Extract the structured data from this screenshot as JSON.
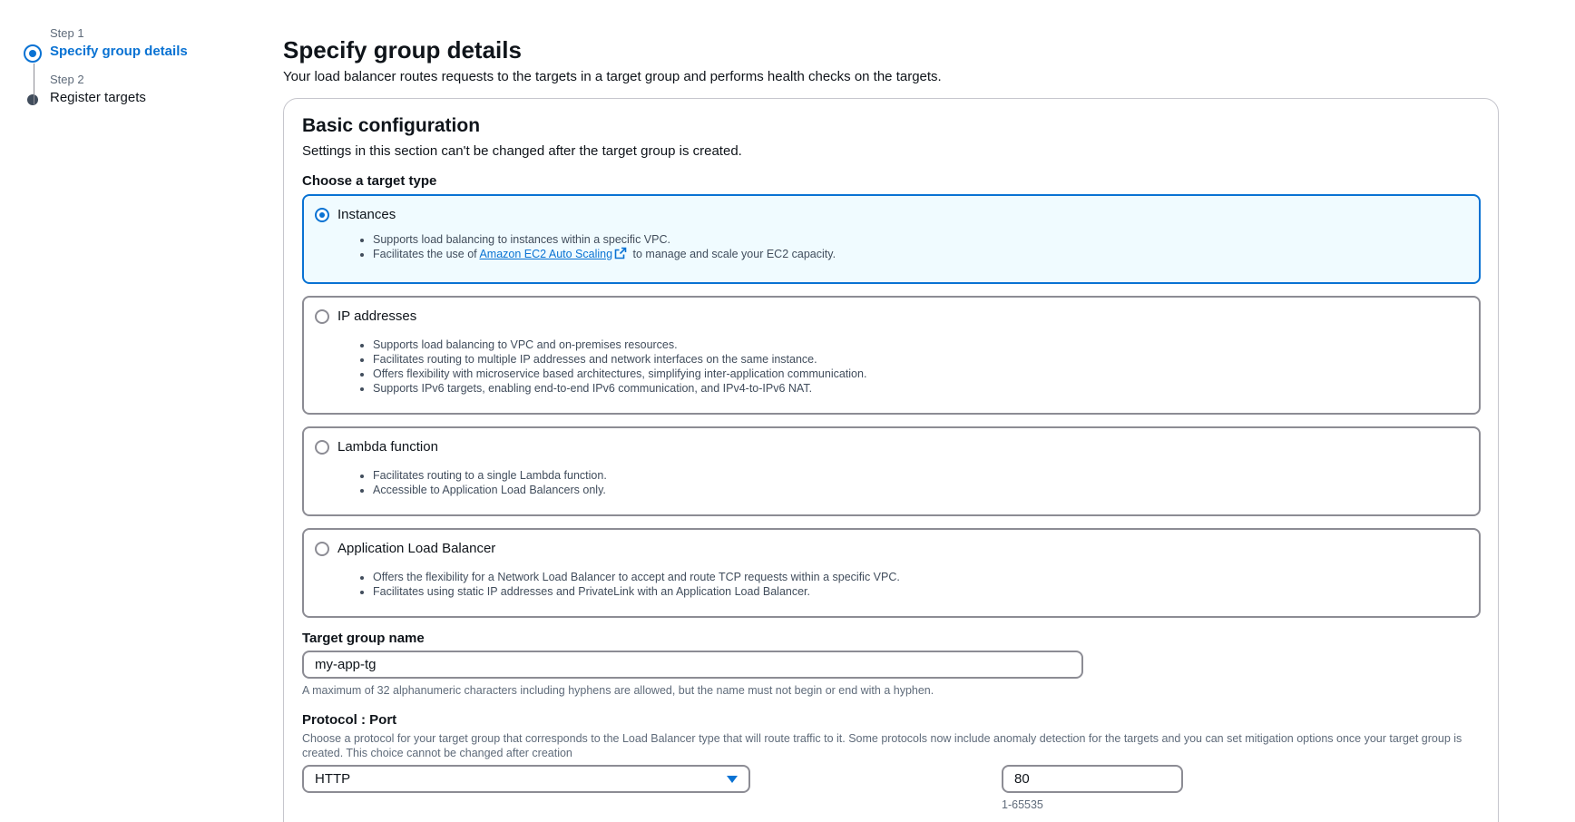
{
  "wizard": {
    "steps": [
      {
        "number": "Step 1",
        "title": "Specify group details",
        "state": "active"
      },
      {
        "number": "Step 2",
        "title": "Register targets",
        "state": "inactive"
      }
    ]
  },
  "page": {
    "title": "Specify group details",
    "description": "Your load balancer routes requests to the targets in a target group and performs health checks on the targets."
  },
  "basic_config": {
    "title": "Basic configuration",
    "description": "Settings in this section can't be changed after the target group is created.",
    "target_type_label": "Choose a target type",
    "target_types": [
      {
        "label": "Instances",
        "selected": true,
        "bullets": [
          "Supports load balancing to instances within a specific VPC."
        ],
        "link_bullet": {
          "prefix": "Facilitates the use of ",
          "link": "Amazon EC2 Auto Scaling",
          "suffix": " to manage and scale your EC2 capacity."
        }
      },
      {
        "label": "IP addresses",
        "selected": false,
        "bullets": [
          "Supports load balancing to VPC and on-premises resources.",
          "Facilitates routing to multiple IP addresses and network interfaces on the same instance.",
          "Offers flexibility with microservice based architectures, simplifying inter-application communication.",
          "Supports IPv6 targets, enabling end-to-end IPv6 communication, and IPv4-to-IPv6 NAT."
        ]
      },
      {
        "label": "Lambda function",
        "selected": false,
        "bullets": [
          "Facilitates routing to a single Lambda function.",
          "Accessible to Application Load Balancers only."
        ]
      },
      {
        "label": "Application Load Balancer",
        "selected": false,
        "bullets": [
          "Offers the flexibility for a Network Load Balancer to accept and route TCP requests within a specific VPC.",
          "Facilitates using static IP addresses and PrivateLink with an Application Load Balancer."
        ]
      }
    ],
    "name_field": {
      "label": "Target group name",
      "value": "my-app-tg",
      "hint": "A maximum of 32 alphanumeric characters including hyphens are allowed, but the name must not begin or end with a hyphen."
    },
    "protocol_port": {
      "label": "Protocol : Port",
      "description": "Choose a protocol for your target group that corresponds to the Load Balancer type that will route traffic to it. Some protocols now include anomaly detection for the targets and you can set mitigation options once your target group is created. This choice cannot be changed after creation",
      "protocol_value": "HTTP",
      "port_value": "80",
      "port_hint": "1-65535"
    }
  },
  "colors": {
    "accent": "#0972d3",
    "selected_bg": "#f0fbff",
    "border": "#8c8c94",
    "text_secondary": "#5f6b7a"
  },
  "icons": {
    "external_link": "external-link-icon",
    "select_caret": "caret-down-icon"
  }
}
